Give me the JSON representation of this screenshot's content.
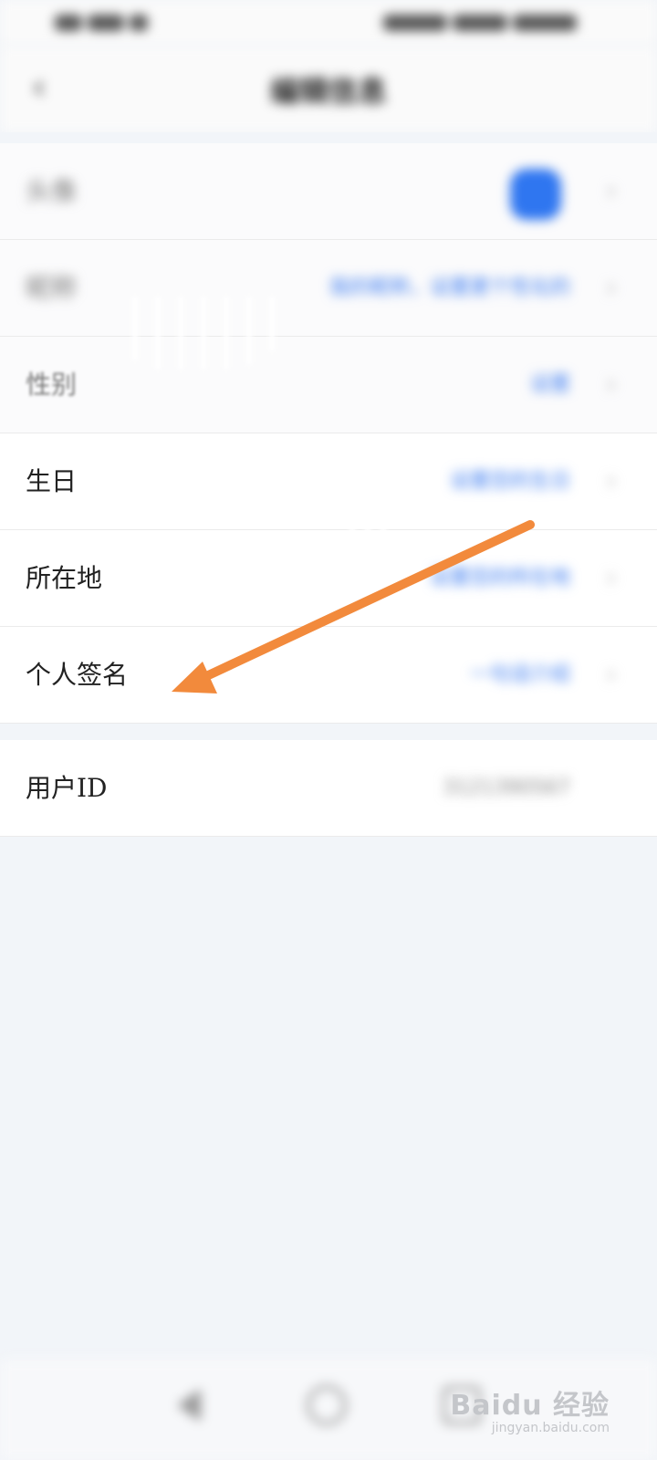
{
  "header": {
    "title": "编辑信息"
  },
  "rows": [
    {
      "label": "头像",
      "value": ""
    },
    {
      "label": "昵称",
      "value": "我的昵称，设置更个性化的"
    },
    {
      "label": "性别",
      "value": "设置"
    },
    {
      "label": "生日",
      "value": "设置您的生日"
    },
    {
      "label": "所在地",
      "value": "设置您的所在地"
    },
    {
      "label": "个人签名",
      "value": "一句话介绍"
    }
  ],
  "user_id": {
    "label": "用户ID",
    "value": "3121390567"
  },
  "watermark": {
    "brand": "Baidu 经验",
    "sub": "jingyan.baidu.com"
  },
  "colors": {
    "accent": "#3b7bf0",
    "arrow": "#f28a3c",
    "background": "#f2f5f9"
  },
  "icons": [
    "back-chevron-icon",
    "chevron-right-icon",
    "nav-back-icon",
    "nav-home-icon",
    "nav-recents-icon",
    "arrow-annotation-icon"
  ]
}
